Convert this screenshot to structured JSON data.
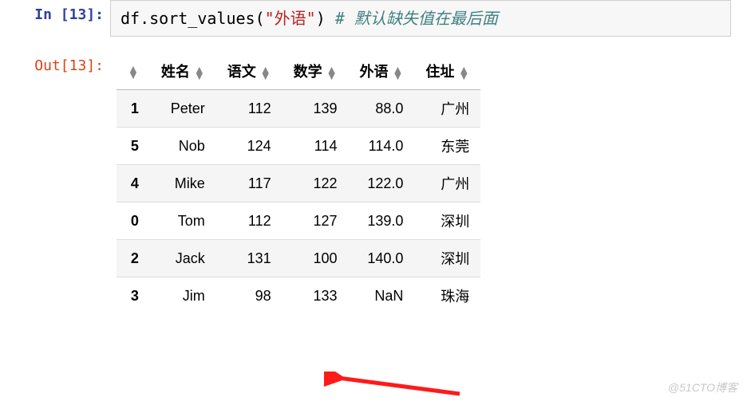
{
  "prompts": {
    "in_label": "In [13]:",
    "out_label": "Out[13]:"
  },
  "code": {
    "obj": "df",
    "method": ".sort_values",
    "open": "(",
    "arg": "\"外语\"",
    "close": ")",
    "spacer": "   ",
    "comment": "# 默认缺失值在最后面"
  },
  "table": {
    "columns": [
      "",
      "姓名",
      "语文",
      "数学",
      "外语",
      "住址"
    ],
    "rows": [
      {
        "index": "1",
        "cells": [
          "Peter",
          "112",
          "139",
          "88.0",
          "广州"
        ]
      },
      {
        "index": "5",
        "cells": [
          "Nob",
          "124",
          "114",
          "114.0",
          "东莞"
        ]
      },
      {
        "index": "4",
        "cells": [
          "Mike",
          "117",
          "122",
          "122.0",
          "广州"
        ]
      },
      {
        "index": "0",
        "cells": [
          "Tom",
          "112",
          "127",
          "139.0",
          "深圳"
        ]
      },
      {
        "index": "2",
        "cells": [
          "Jack",
          "131",
          "100",
          "140.0",
          "深圳"
        ]
      },
      {
        "index": "3",
        "cells": [
          "Jim",
          "98",
          "133",
          "NaN",
          "珠海"
        ]
      }
    ]
  },
  "watermark": "@51CTO博客",
  "chart_data": {
    "type": "table",
    "title": "df.sort_values(\"外语\")",
    "note": "默认缺失值在最后面 (NaN placed at end by default)",
    "columns": [
      "index",
      "姓名",
      "语文",
      "数学",
      "外语",
      "住址"
    ],
    "rows": [
      [
        1,
        "Peter",
        112,
        139,
        88.0,
        "广州"
      ],
      [
        5,
        "Nob",
        124,
        114,
        114.0,
        "东莞"
      ],
      [
        4,
        "Mike",
        117,
        122,
        122.0,
        "广州"
      ],
      [
        0,
        "Tom",
        112,
        127,
        139.0,
        "深圳"
      ],
      [
        2,
        "Jack",
        131,
        100,
        140.0,
        "深圳"
      ],
      [
        3,
        "Jim",
        98,
        133,
        null,
        "珠海"
      ]
    ],
    "sorted_by": "外语",
    "sort_order": "ascending"
  }
}
